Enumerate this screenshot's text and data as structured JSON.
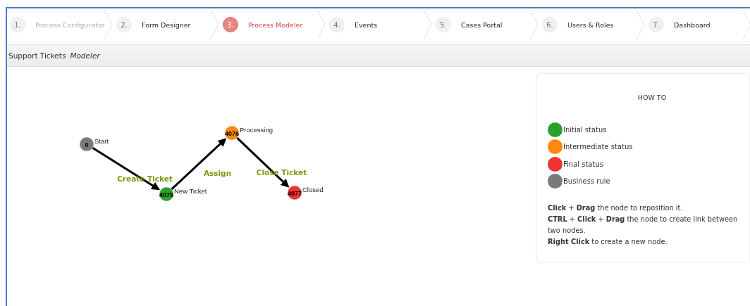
{
  "steps": [
    {
      "number": "1.",
      "label": "Process Configurator",
      "selected": false,
      "disabled": true
    },
    {
      "number": "2.",
      "label": "Form Designer",
      "selected": false,
      "disabled": false
    },
    {
      "number": "3.",
      "label": "Process Modeler",
      "selected": true,
      "disabled": false
    },
    {
      "number": "4.",
      "label": "Events",
      "selected": false,
      "disabled": false
    },
    {
      "number": "5.",
      "label": "Cases Portal",
      "selected": false,
      "disabled": false
    },
    {
      "number": "6.",
      "label": "Users & Roles",
      "selected": false,
      "disabled": false
    },
    {
      "number": "7.",
      "label": "Dashboard",
      "selected": false,
      "disabled": false
    }
  ],
  "header": {
    "title": "Support Tickets",
    "subtitle": "Modeler"
  },
  "graph": {
    "nodes": [
      {
        "id": "0",
        "label": "Start",
        "color": "#7a7a7a"
      },
      {
        "id": "4075",
        "label": "New Ticket",
        "color": "#2ca02c"
      },
      {
        "id": "4076",
        "label": "Processing",
        "color": "#ff880e"
      },
      {
        "id": "4077",
        "label": "Closed",
        "color": "#f03232"
      }
    ],
    "edges": [
      {
        "label": "Create Ticket"
      },
      {
        "label": "Assign"
      },
      {
        "label": "Close Ticket"
      }
    ]
  },
  "help": {
    "title": "HOW TO",
    "legend": [
      {
        "label": "Initial status",
        "color": "#2ca02c"
      },
      {
        "label": "Intermediate status",
        "color": "#ff880e"
      },
      {
        "label": "Final status",
        "color": "#f03232"
      },
      {
        "label": "Business rule",
        "color": "#7a7a7a"
      }
    ],
    "instructions": [
      "**Click** + **Drag** the node to reposition it.",
      "**CTRL** + **Click** + **Drag** the node to create link between two nodes.",
      "**Right Click** to create a new node."
    ]
  }
}
